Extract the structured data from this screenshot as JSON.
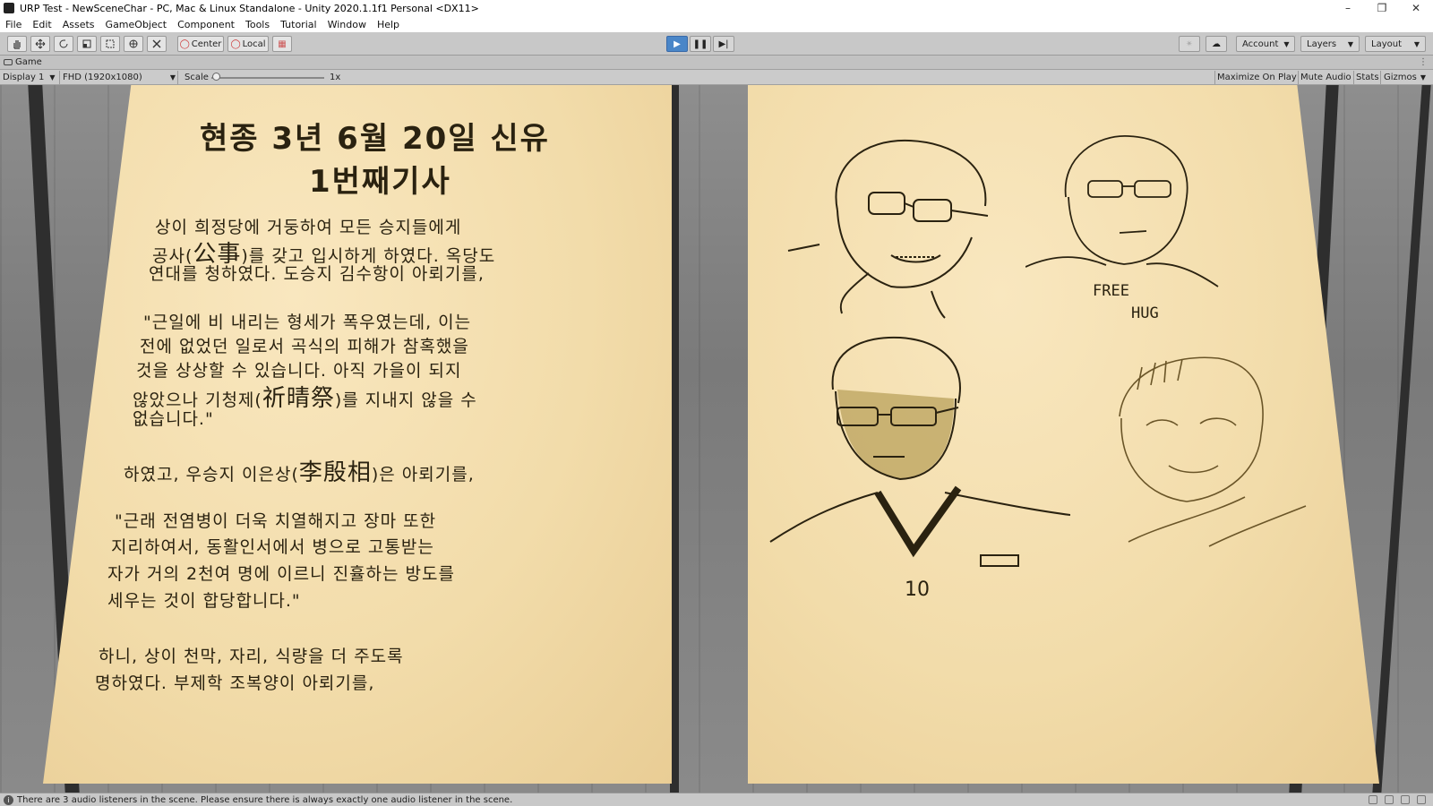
{
  "window": {
    "title": "URP Test - NewSceneChar - PC, Mac & Linux Standalone - Unity 2020.1.1f1 Personal <DX11>",
    "controls": [
      "–",
      "❐",
      "✕"
    ]
  },
  "menu": [
    "File",
    "Edit",
    "Assets",
    "GameObject",
    "Component",
    "Tools",
    "Tutorial",
    "Window",
    "Help"
  ],
  "toolbar": {
    "pivot_label": "Center",
    "space_label": "Local",
    "account_label": "Account",
    "layers_label": "Layers",
    "layout_label": "Layout"
  },
  "game_tab": {
    "label": "Game"
  },
  "game_bar": {
    "display": "Display 1",
    "resolution": "FHD (1920x1080)",
    "scale_label": "Scale",
    "scale_value": "1x",
    "scale_fraction": 0.0,
    "maximize": "Maximize On Play",
    "mute": "Mute Audio",
    "stats": "Stats",
    "gizmos": "Gizmos"
  },
  "document": {
    "headline_1": "현종 3년 6월 20일 신유",
    "headline_2": "1번째기사",
    "p1_l1": "상이 희정당에 거둥하여 모든 승지들에게",
    "p1_l2a": "공사(",
    "p1_l2_han": "公事",
    "p1_l2b": ")를 갖고 입시하게 하였다. 옥당도",
    "p1_l3": "연대를 청하였다. 도승지 김수항이 아뢰기를,",
    "p2_l1": "\"근일에 비 내리는 형세가 폭우였는데, 이는",
    "p2_l2": "전에 없었던 일로서 곡식의 피해가 참혹했을",
    "p2_l3": "것을 상상할 수 있습니다. 아직 가을이 되지",
    "p2_l4a": "않았으나 기청제(",
    "p2_l4_han": "祈晴祭",
    "p2_l4b": ")를 지내지 않을 수",
    "p2_l5": "없습니다.\"",
    "p3_a": "하였고, 우승지 이은상(",
    "p3_han": "李殷相",
    "p3_b": ")은 아뢰기를,",
    "p4_l1": "\"근래 전염병이 더욱 치열해지고 장마 또한",
    "p4_l2": "지리하여서, 동활인서에서 병으로 고통받는",
    "p4_l3": "자가 거의 2천여 명에 이르니 진휼하는 방도를",
    "p4_l4": "세우는 것이 합당합니다.\"",
    "p5_l1": "하니, 상이 천막, 자리, 식량을 더 주도록",
    "p5_l2": "명하였다. 부제학 조복양이 아뢰기를,"
  },
  "sketches": {
    "shirt_text_1": "FREE",
    "shirt_text_2": "HUG",
    "number_text": "10"
  },
  "status": {
    "message": "There are 3 audio listeners in the scene. Please ensure there is always exactly one audio listener in the scene."
  },
  "colors": {
    "paper": "#f2dcaa",
    "ink": "#2a2210",
    "play_accent": "#4a86c8"
  }
}
